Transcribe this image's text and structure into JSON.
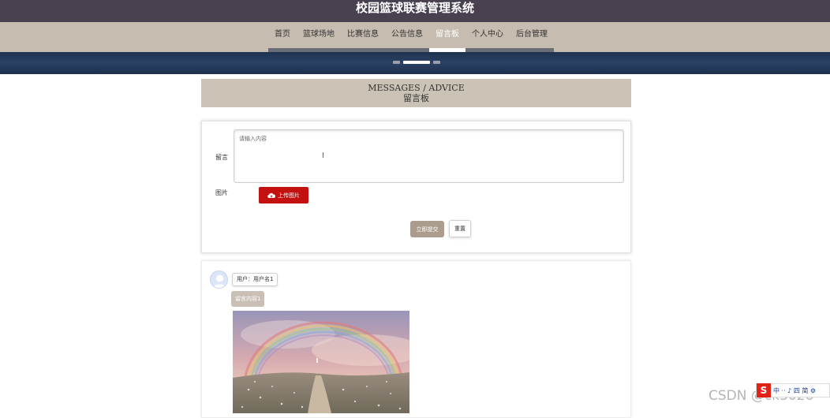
{
  "header": {
    "title": "校园篮球联赛管理系统"
  },
  "nav": {
    "items": [
      {
        "label": "首页"
      },
      {
        "label": "篮球场地"
      },
      {
        "label": "比赛信息"
      },
      {
        "label": "公告信息"
      },
      {
        "label": "留言板",
        "active": true
      },
      {
        "label": "个人中心"
      },
      {
        "label": "后台管理"
      }
    ]
  },
  "section": {
    "title_en": "MESSAGES / ADVICE",
    "title_cn": "留言板"
  },
  "form": {
    "message_label": "留言",
    "message_placeholder": "请输入内容",
    "image_label": "图片",
    "upload_button": "上传图片",
    "submit_button": "立即提交",
    "reset_button": "重置"
  },
  "messages": [
    {
      "user": "用户：用户名1",
      "content": "留言内容1"
    }
  ],
  "watermark": {
    "csdn": "CSDN @ck3026",
    "sohu_letter": "S",
    "sohu_text": "中 ·· ♪ 四 简 ⚙"
  },
  "colors": {
    "topbar": "#4a4150",
    "navbar": "#c6bcaf",
    "upload_button": "#c2110f",
    "submit_button": "#ab9c8e"
  }
}
